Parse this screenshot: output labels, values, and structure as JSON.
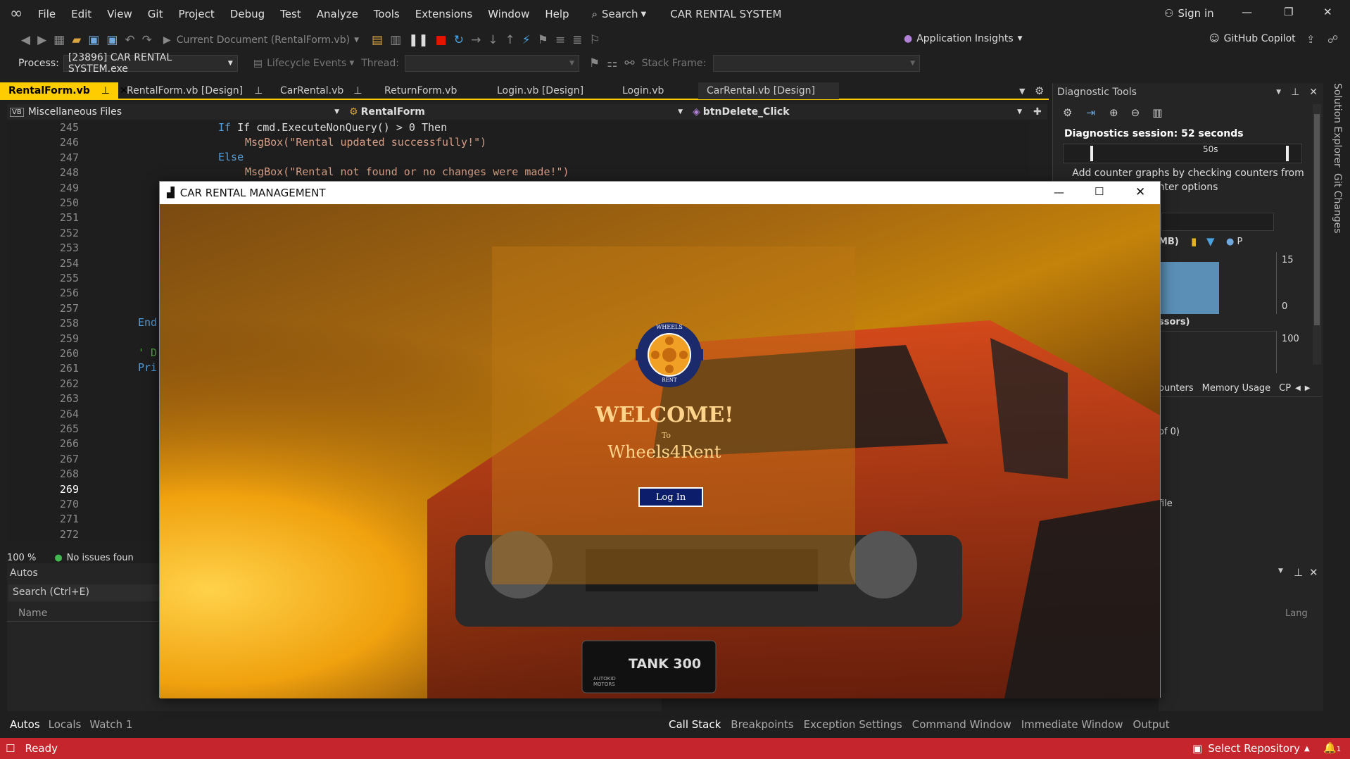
{
  "titlebar": {
    "menu": [
      "File",
      "Edit",
      "View",
      "Git",
      "Project",
      "Debug",
      "Test",
      "Analyze",
      "Tools",
      "Extensions",
      "Window",
      "Help"
    ],
    "search_label": "Search",
    "solution_name": "CAR RENTAL SYSTEM",
    "signin_label": "Sign in"
  },
  "toolbar": {
    "run_target": "Current Document (RentalForm.vb)",
    "app_insights": "Application Insights",
    "copilot": "GitHub Copilot",
    "process_label": "Process:",
    "process_value": "[23896] CAR RENTAL SYSTEM.exe",
    "lifecycle": "Lifecycle Events",
    "thread_label": "Thread:",
    "stack_frame_label": "Stack Frame:"
  },
  "tabs": [
    {
      "label": "RentalForm.vb",
      "active": true
    },
    {
      "label": "RentalForm.vb [Design]"
    },
    {
      "label": "CarRental.vb"
    },
    {
      "label": "ReturnForm.vb"
    },
    {
      "label": "Login.vb [Design]"
    },
    {
      "label": "Login.vb"
    },
    {
      "label": "CarRental.vb [Design]"
    }
  ],
  "navbar": {
    "scope": "Miscellaneous Files",
    "class": "RentalForm",
    "member": "btnDelete_Click"
  },
  "editor": {
    "line_numbers": [
      "245",
      "246",
      "247",
      "248",
      "249",
      "250",
      "251",
      "252",
      "253",
      "254",
      "255",
      "256",
      "257",
      "258",
      "259",
      "260",
      "261",
      "262",
      "263",
      "264",
      "265",
      "266",
      "267",
      "268",
      "269",
      "270",
      "271",
      "272"
    ],
    "line1": "If cmd.ExecuteNonQuery() > 0 Then",
    "line2": "MsgBox(\"Rental updated successfully!\")",
    "line3": "Else",
    "line4": "MsgBox(\"Rental not found or no changes were made!\")",
    "frag_end": "End",
    "frag_comment": "' D",
    "frag_pri": "Pri",
    "zoom": "100 %",
    "issues": "No issues foun"
  },
  "diagnostics": {
    "title": "Diagnostic Tools",
    "session": "Diagnostics session: 52 seconds",
    "time_tick": "50s",
    "counter_msg_1": "Add counter graphs by checking counters from",
    "counter_msg_2": "nter options",
    "mb_label": "MB)",
    "p_label": "P",
    "val_15": "15",
    "val_0": "0",
    "processors": "ssors)",
    "val_100": "100",
    "tabs": [
      "ounters",
      "Memory Usage",
      "CP"
    ],
    "of0": "of 0)",
    "file": "file",
    "lang": "Lang"
  },
  "autos": {
    "title": "Autos",
    "search": "Search (Ctrl+E)",
    "name_col": "Name"
  },
  "bottom_left_tabs": [
    "Autos",
    "Locals",
    "Watch 1"
  ],
  "bottom_right_tabs": [
    "Call Stack",
    "Breakpoints",
    "Exception Settings",
    "Command Window",
    "Immediate Window",
    "Output"
  ],
  "side_tabs": [
    "Solution Explorer",
    "Git Changes"
  ],
  "status": {
    "ready": "Ready",
    "repo": "Select Repository",
    "notif": "1"
  },
  "dialog": {
    "title": "CAR RENTAL MANAGEMENT",
    "logo_top": "WHEELS",
    "logo_bottom": "RENT",
    "welcome": "WELCOME!",
    "to": "To",
    "brand": "Wheels4Rent",
    "login": "Log In",
    "plate_brand": "TANK 300",
    "plate_sub": "AUTOKID MOTORS"
  },
  "colors": {
    "accent": "#ffcc00",
    "status": "#c5252c",
    "login_btn": "#0b1d6b"
  }
}
